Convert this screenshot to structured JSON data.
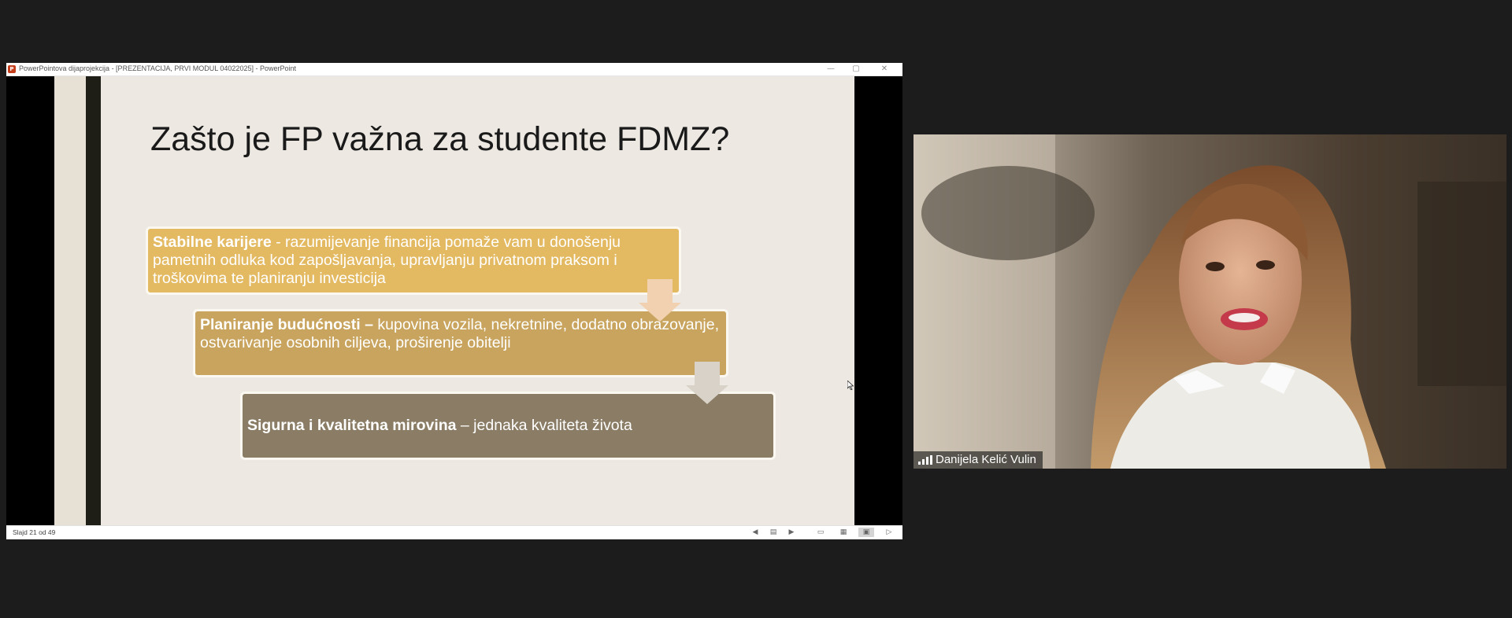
{
  "window": {
    "app_icon_letter": "P",
    "title": "PowerPointova dijaprojekcija - [PREZENTACIJA, PRVI MODUL 04022025] - PowerPoint",
    "controls": {
      "minimize": "—",
      "maximize": "▢",
      "close": "✕"
    }
  },
  "slide": {
    "title": "Zašto je FP važna za studente FDMZ?",
    "items": [
      {
        "bold": "Stabilne karijere",
        "text": " - razumijevanje financija pomaže vam u donošenju pametnih odluka kod zapošljavanja, upravljanju privatnom praksom i troškovima te planiranju investicija"
      },
      {
        "bold": "Planiranje budućnosti –",
        "text": " kupovina vozila, nekretnine, dodatno obrazovanje, ostvarivanje osobnih ciljeva, proširenje obitelji"
      },
      {
        "bold": "Sigurna i kvalitetna mirovina",
        "text": " – jednaka kvaliteta života"
      }
    ],
    "colors": {
      "box1": "#e3b962",
      "box2": "#c8a45e",
      "box3": "#8a7c65",
      "background": "#ede9e2"
    }
  },
  "status_bar": {
    "slide_counter": "Slajd 21 od 49",
    "icons": [
      "previous-slide-icon",
      "slide-menu-icon",
      "next-slide-icon",
      "normal-view-icon",
      "slide-sorter-icon",
      "reading-view-icon",
      "slideshow-icon"
    ]
  },
  "participant": {
    "name": "Danijela Kelić Vulin",
    "icon": "signal-strength-icon"
  }
}
